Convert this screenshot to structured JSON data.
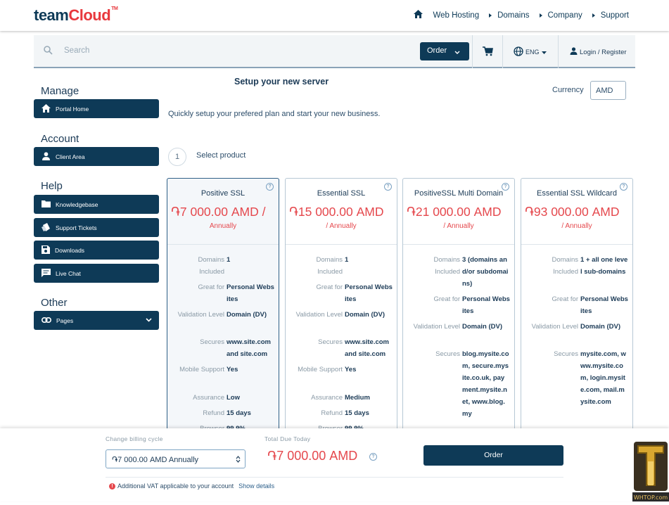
{
  "brand": {
    "logo_a": "team",
    "logo_b": "Cloud",
    "tm": "TM"
  },
  "nav": {
    "items": [
      "Web Hosting",
      "Domains",
      "Company",
      "Support"
    ]
  },
  "search": {
    "placeholder": "Search",
    "order_label": "Order",
    "lang": "ENG",
    "login": "Login / Register"
  },
  "sidebar": {
    "sections": [
      {
        "heading": "Manage",
        "items": [
          {
            "label": "Portal Home",
            "icon": "home-icon"
          }
        ]
      },
      {
        "heading": "Account",
        "items": [
          {
            "label": "Client Area",
            "icon": "user-icon"
          }
        ]
      },
      {
        "heading": "Help",
        "items": [
          {
            "label": "Knowledgebase",
            "icon": "folder-icon"
          },
          {
            "label": "Support Tickets",
            "icon": "tickets-icon"
          },
          {
            "label": "Downloads",
            "icon": "save-icon"
          },
          {
            "label": "Live Chat",
            "icon": "chat-icon"
          }
        ]
      },
      {
        "heading": "Other",
        "items": [
          {
            "label": "Pages",
            "icon": "link-icon"
          }
        ]
      }
    ]
  },
  "main": {
    "title": "Setup your new server",
    "subtitle": "Quickly setup your prefered plan and start your new business.",
    "currency_label": "Currency",
    "currency_value": "AMD",
    "step_number": "1",
    "step_label": "Select product"
  },
  "products": [
    {
      "name": "Positive SSL",
      "price": "֏7 000.00 AMD /",
      "cycle": "Annually",
      "features": [
        {
          "k": "Domains Included",
          "v": "1"
        },
        {
          "k": "Great for",
          "v": "Personal Websites"
        },
        {
          "k": "Validation Level",
          "v": "Domain (DV)"
        },
        {
          "k": "Secures",
          "v": "www.site.com and site.com"
        },
        {
          "k": "Mobile Support",
          "v": "Yes"
        },
        {
          "k": "Assurance",
          "v": "Low"
        },
        {
          "k": "Refund",
          "v": "15 days"
        },
        {
          "k": "Browser",
          "v": "99.9%"
        }
      ]
    },
    {
      "name": "Essential SSL",
      "price": "֏15 000.00 AMD",
      "cycle": "/ Annually",
      "features": [
        {
          "k": "Domains Included",
          "v": "1"
        },
        {
          "k": "Great for",
          "v": "Personal Websites"
        },
        {
          "k": "Validation Level",
          "v": "Domain (DV)"
        },
        {
          "k": "Secures",
          "v": "www.site.com and site.com"
        },
        {
          "k": "Mobile Support",
          "v": "Yes"
        },
        {
          "k": "Assurance",
          "v": "Medium"
        },
        {
          "k": "Refund",
          "v": "15 days"
        },
        {
          "k": "Browser",
          "v": "99.9%"
        }
      ]
    },
    {
      "name": "PositiveSSL Multi Domain",
      "price": "֏21 000.00 AMD",
      "cycle": "/ Annually",
      "features": [
        {
          "k": "Domains Included",
          "v": "3 (domains and/or subdomains)"
        },
        {
          "k": "Great for",
          "v": "Personal Websites"
        },
        {
          "k": "Validation Level",
          "v": "Domain (DV)"
        },
        {
          "k": "Secures",
          "v": "blog.mysite.com, secure.mysite.co.uk, payment.mysite.net, www.blog.my"
        }
      ]
    },
    {
      "name": "Essential SSL Wildcard",
      "price": "֏93 000.00 AMD",
      "cycle": "/ Annually",
      "features": [
        {
          "k": "Domains Included",
          "v": "1 + all one level sub-domains"
        },
        {
          "k": "Great for",
          "v": "Personal Websites"
        },
        {
          "k": "Validation Level",
          "v": "Domain (DV)"
        },
        {
          "k": "Secures",
          "v": "mysite.com, www.mysite.com, login.mysite.com, mail.mysite.com"
        }
      ]
    }
  ],
  "bottom": {
    "billing_label": "Change billing cycle",
    "billing_value": "֏7 000.00 AMD Annually",
    "total_label": "Total Due Today",
    "total_value": "֏7 000.00 AMD",
    "order_label": "Order",
    "vat_text": "Additional VAT applicable to your account",
    "vat_link": "Show details"
  },
  "watermark": {
    "logo": "WHTOP.com"
  },
  "colors": {
    "primary": "#0e3a57",
    "accent": "#e8383d",
    "price": "#e5484d"
  }
}
